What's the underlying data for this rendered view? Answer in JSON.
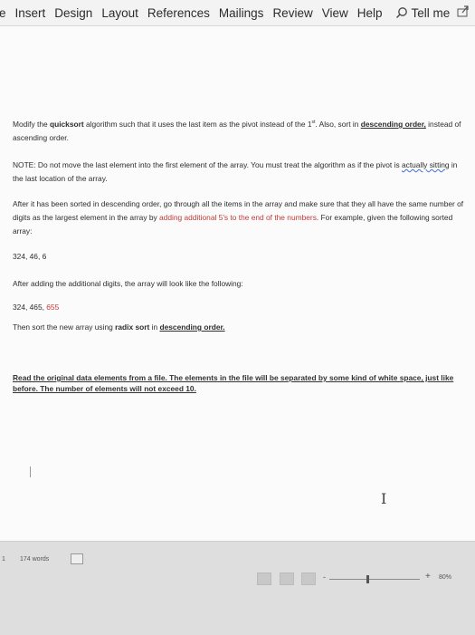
{
  "ribbon": {
    "tabs": [
      "e",
      "Insert",
      "Design",
      "Layout",
      "References",
      "Mailings",
      "Review",
      "View",
      "Help"
    ],
    "tell_me": "Tell me"
  },
  "document": {
    "p1": {
      "t1": "Modify the ",
      "t2": "quicksort",
      "t3": " algorithm such that it uses the last item as the pivot instead of the 1",
      "t4": "st",
      "t5": ". Also, sort in ",
      "t6": "descending order,",
      "t7": " instead of ascending order."
    },
    "p2": {
      "t1": "NOTE: Do not move the last element into the first element of the array.  You must treat the algorithm as if the pivot is ",
      "t2": "actually sitting",
      "t3": " in the last location of the array."
    },
    "p3": {
      "t1": "After it has been sorted in descending order, go through all the items in the array and make sure that they all have the same number of digits as the largest element in the array by ",
      "t2": "adding additional 5's to the end of the numbers",
      "t3": ". For example, given the following sorted array:"
    },
    "p4": "324, 46, 6",
    "p5": "After adding the additional digits, the array will look like the following:",
    "p6": {
      "t1": "324, 465, ",
      "t2": "655"
    },
    "p7": {
      "t1": "Then sort the new array using ",
      "t2": "radix sort",
      "t3": " in ",
      "t4": "descending order."
    },
    "p8": "Read the original data elements from a file. The elements in the file will be separated by some kind of white space, just like before. The number of elements will not exceed 10."
  },
  "status": {
    "page": "1",
    "word_count": "174 words",
    "zoom_minus": "-",
    "zoom_plus": "+",
    "zoom_level": "80%"
  },
  "icons": [
    "search-icon",
    "share-icon",
    "proofing-icon"
  ]
}
